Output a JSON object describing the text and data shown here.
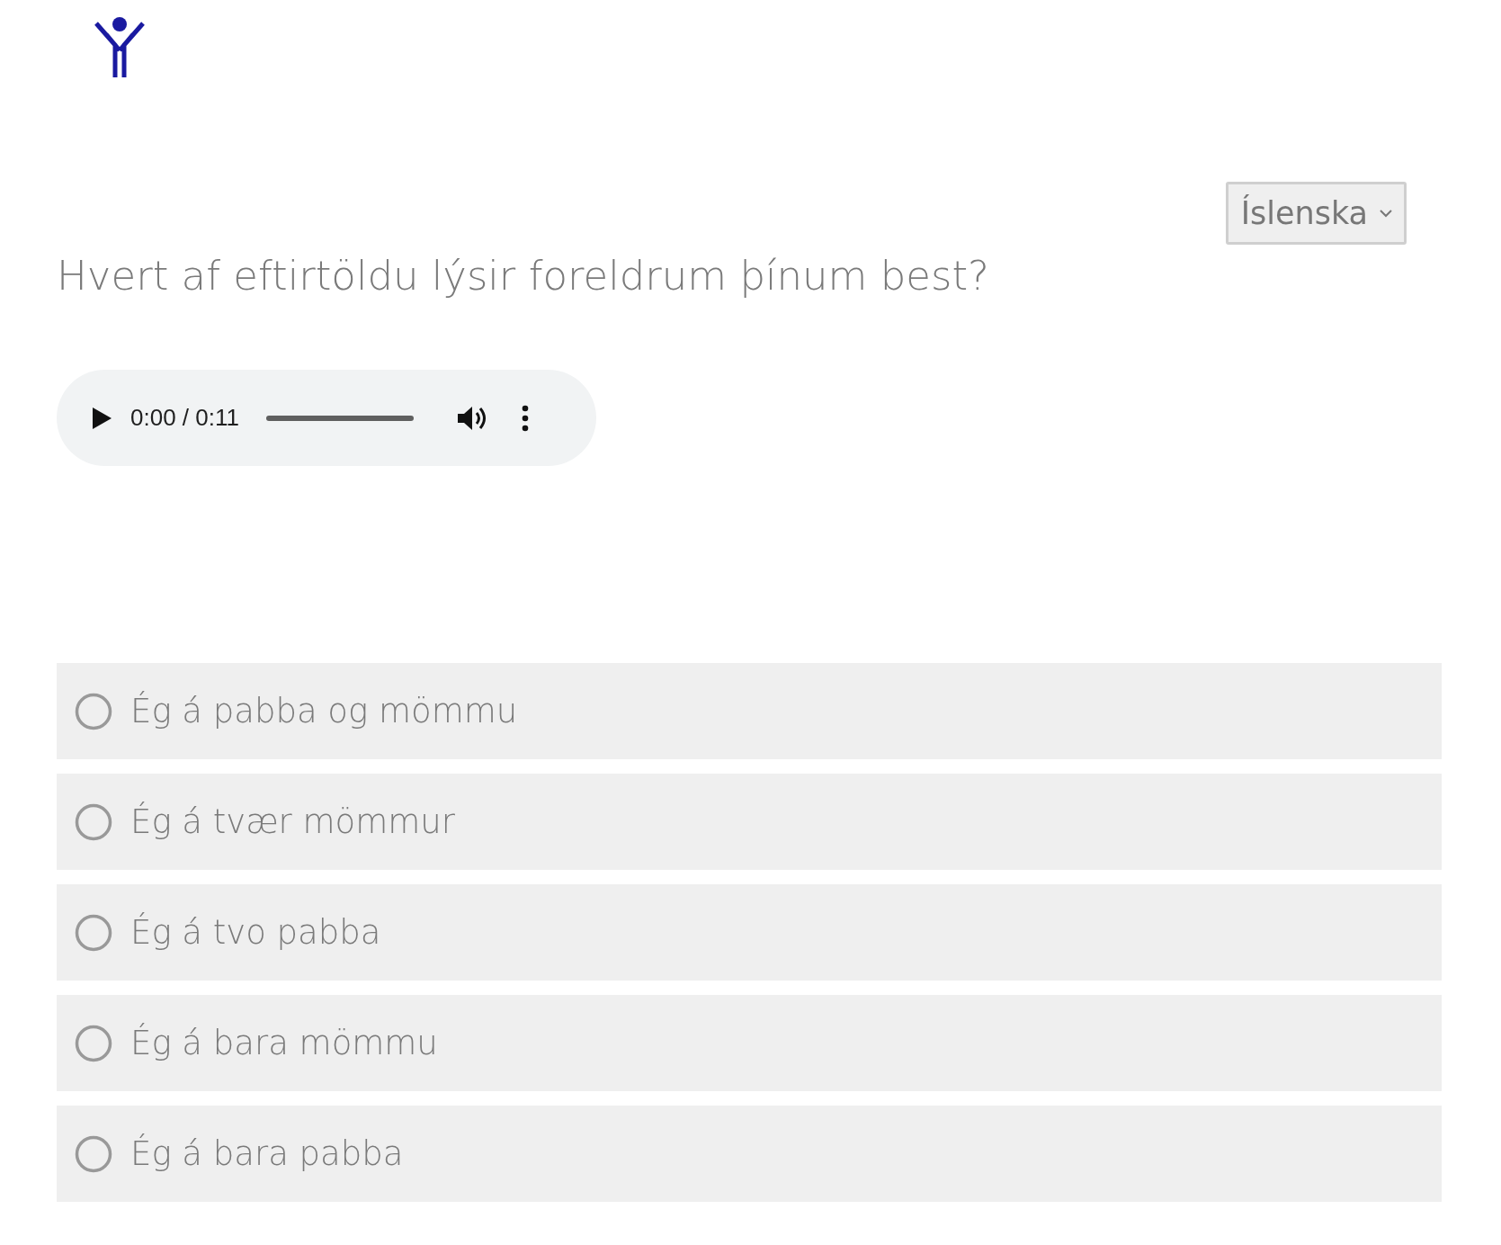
{
  "language_select": {
    "value": "Íslenska"
  },
  "question": "Hvert af eftirtöldu lýsir foreldrum þínum best?",
  "audio": {
    "time": "0:00 / 0:11"
  },
  "options": [
    {
      "label": "Ég á pabba og mömmu",
      "selected": false
    },
    {
      "label": "Ég á tvær mömmur",
      "selected": false
    },
    {
      "label": "Ég á tvo pabba",
      "selected": false
    },
    {
      "label": "Ég á bara mömmu",
      "selected": false
    },
    {
      "label": "Ég á bara pabba",
      "selected": false
    }
  ]
}
